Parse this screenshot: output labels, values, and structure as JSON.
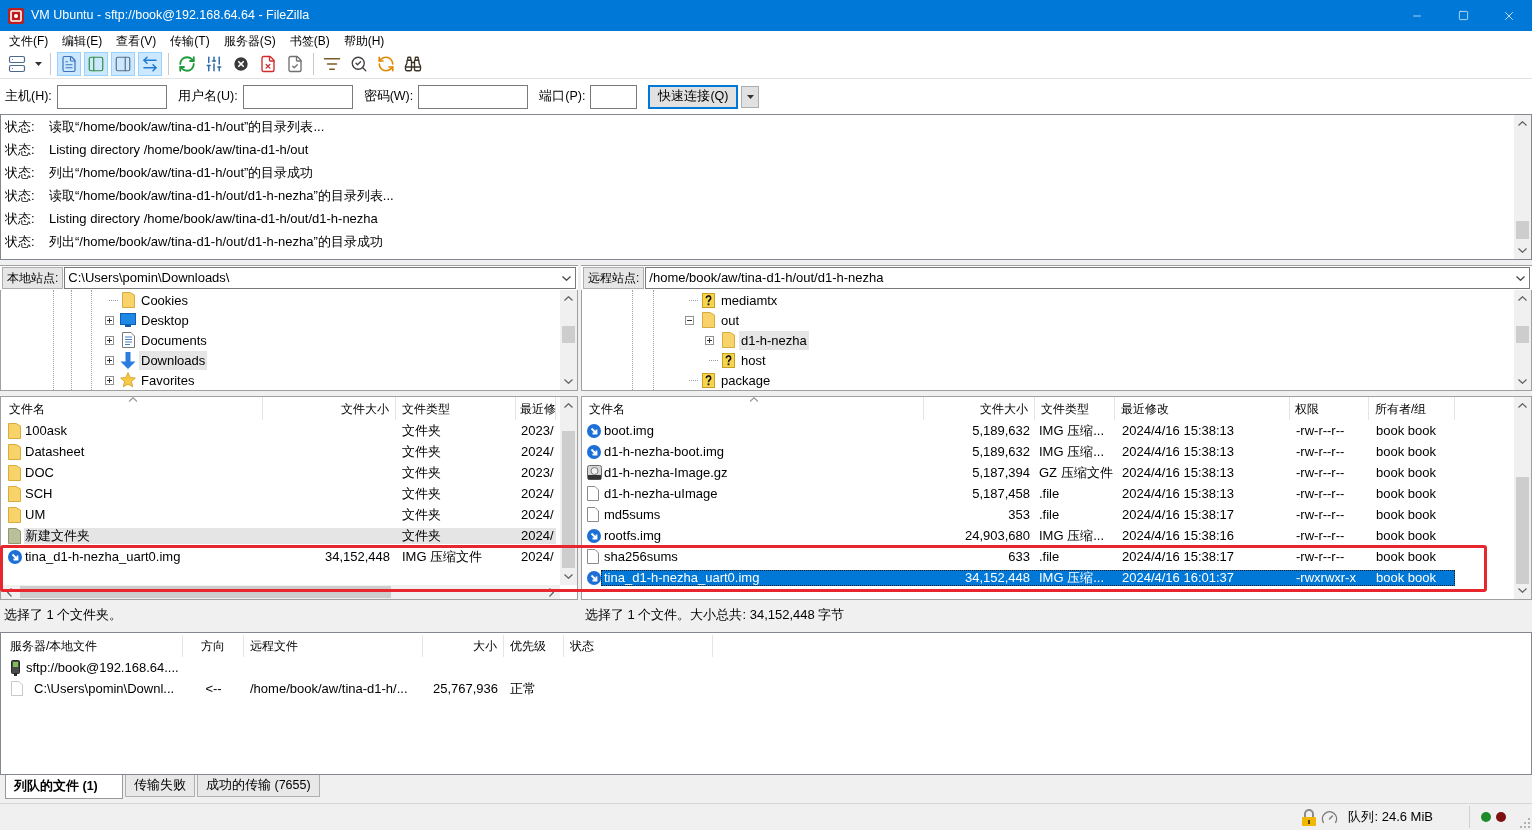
{
  "window": {
    "title": "VM Ubuntu - sftp://book@192.168.64.64 - FileZilla"
  },
  "menu": [
    "文件(F)",
    "编辑(E)",
    "查看(V)",
    "传输(T)",
    "服务器(S)",
    "书签(B)",
    "帮助(H)"
  ],
  "view_toggles": [
    {
      "pressed": true
    },
    {
      "pressed": true
    },
    {
      "pressed": true
    },
    {
      "pressed": true
    }
  ],
  "quickconnect": {
    "fields": [
      {
        "kind": "host",
        "label": "主机(H):"
      },
      {
        "kind": "user",
        "label": "用户名(U):"
      },
      {
        "kind": "password",
        "label": "密码(W):"
      },
      {
        "kind": "port",
        "label": "端口(P):"
      }
    ],
    "button": "快速连接(Q)"
  },
  "log": [
    {
      "label": "状态:",
      "text": "读取“/home/book/aw/tina-d1-h/out”的目录列表..."
    },
    {
      "label": "状态:",
      "text": "Listing directory /home/book/aw/tina-d1-h/out"
    },
    {
      "label": "状态:",
      "text": "列出“/home/book/aw/tina-d1-h/out”的目录成功"
    },
    {
      "label": "状态:",
      "text": "读取“/home/book/aw/tina-d1-h/out/d1-h-nezha”的目录列表..."
    },
    {
      "label": "状态:",
      "text": "Listing directory /home/book/aw/tina-d1-h/out/d1-h-nezha"
    },
    {
      "label": "状态:",
      "text": "列出“/home/book/aw/tina-d1-h/out/d1-h-nezha”的目录成功"
    }
  ],
  "local": {
    "site_label": "本地站点:",
    "path": "C:\\Users\\pomin\\Downloads\\",
    "tree": [
      {
        "name": "Cookies",
        "kind": "folder",
        "expandable": false,
        "selected": false
      },
      {
        "name": "Desktop",
        "kind": "desktop",
        "expandable": true,
        "expanded": false,
        "selected": false
      },
      {
        "name": "Documents",
        "kind": "document",
        "expandable": true,
        "expanded": false,
        "selected": false
      },
      {
        "name": "Downloads",
        "kind": "download",
        "expandable": true,
        "expanded": false,
        "selected": true
      },
      {
        "name": "Favorites",
        "kind": "star",
        "expandable": true,
        "expanded": false,
        "selected": false
      }
    ],
    "focused": false,
    "columns": [
      {
        "label": "文件名",
        "sorted": true
      },
      {
        "label": "文件大小",
        "sorted": false
      },
      {
        "label": "文件类型",
        "sorted": false
      },
      {
        "label": "最近修",
        "sorted": false
      }
    ],
    "rows": [
      {
        "kind": "folder",
        "name": "100ask",
        "type": "文件夹",
        "modified": "2023/",
        "selected": false
      },
      {
        "kind": "folder",
        "name": "Datasheet",
        "type": "文件夹",
        "modified": "2024/",
        "selected": false
      },
      {
        "kind": "folder",
        "name": "DOC",
        "type": "文件夹",
        "modified": "2023/",
        "selected": false
      },
      {
        "kind": "folder",
        "name": "SCH",
        "type": "文件夹",
        "modified": "2024/",
        "selected": false
      },
      {
        "kind": "folder",
        "name": "UM",
        "type": "文件夹",
        "modified": "2024/",
        "selected": false
      },
      {
        "kind": "folder",
        "name": "新建文件夹",
        "type": "文件夹",
        "modified": "2024/",
        "selected": true
      },
      {
        "kind": "img",
        "name": "tina_d1-h-nezha_uart0.img",
        "size": "34,152,448",
        "type": "IMG 压缩文件",
        "modified": "2024/",
        "selected": false
      }
    ],
    "status": "选择了 1 个文件夹。"
  },
  "remote": {
    "site_label": "远程站点:",
    "path": "/home/book/aw/tina-d1-h/out/d1-h-nezha",
    "tree": [
      {
        "name": "mediamtx",
        "kind": "unknown",
        "expandable": false,
        "selected": false
      },
      {
        "name": "out",
        "kind": "folder",
        "expandable": true,
        "expanded": true,
        "selected": false,
        "children": [
          {
            "name": "d1-h-nezha",
            "kind": "folder",
            "expandable": true,
            "expanded": false,
            "selected": true
          },
          {
            "name": "host",
            "kind": "unknown",
            "expandable": false,
            "selected": false
          }
        ]
      },
      {
        "name": "package",
        "kind": "unknown",
        "expandable": false,
        "selected": false
      }
    ],
    "focused": true,
    "columns": [
      {
        "label": "文件名",
        "sorted": true
      },
      {
        "label": "文件大小",
        "sorted": false
      },
      {
        "label": "文件类型",
        "sorted": false
      },
      {
        "label": "最近修改",
        "sorted": false
      },
      {
        "label": "权限",
        "sorted": false
      },
      {
        "label": "所有者/组",
        "sorted": false
      }
    ],
    "rows": [
      {
        "kind": "img",
        "name": "boot.img",
        "size": "5,189,632",
        "type": "IMG 压缩...",
        "modified": "2024/4/16 15:38:13",
        "permissions": "-rw-r--r--",
        "owner": "book book",
        "selected": false
      },
      {
        "kind": "img",
        "name": "d1-h-nezha-boot.img",
        "size": "5,189,632",
        "type": "IMG 压缩...",
        "modified": "2024/4/16 15:38:13",
        "permissions": "-rw-r--r--",
        "owner": "book book",
        "selected": false
      },
      {
        "kind": "gz",
        "name": "d1-h-nezha-Image.gz",
        "size": "5,187,394",
        "type": "GZ 压缩文件",
        "modified": "2024/4/16 15:38:13",
        "permissions": "-rw-r--r--",
        "owner": "book book",
        "selected": false
      },
      {
        "kind": "file",
        "name": "d1-h-nezha-uImage",
        "size": "5,187,458",
        "type": ".file",
        "modified": "2024/4/16 15:38:13",
        "permissions": "-rw-r--r--",
        "owner": "book book",
        "selected": false
      },
      {
        "kind": "file",
        "name": "md5sums",
        "size": "353",
        "type": ".file",
        "modified": "2024/4/16 15:38:17",
        "permissions": "-rw-r--r--",
        "owner": "book book",
        "selected": false
      },
      {
        "kind": "img",
        "name": "rootfs.img",
        "size": "24,903,680",
        "type": "IMG 压缩...",
        "modified": "2024/4/16 15:38:16",
        "permissions": "-rw-r--r--",
        "owner": "book book",
        "selected": false
      },
      {
        "kind": "file",
        "name": "sha256sums",
        "size": "633",
        "type": ".file",
        "modified": "2024/4/16 15:38:17",
        "permissions": "-rw-r--r--",
        "owner": "book book",
        "selected": false
      },
      {
        "kind": "img",
        "name": "tina_d1-h-nezha_uart0.img",
        "size": "34,152,448",
        "type": "IMG 压缩...",
        "modified": "2024/4/16 16:01:37",
        "permissions": "-rwxrwxr-x",
        "owner": "book book",
        "selected": true
      }
    ],
    "status": "选择了 1 个文件。大小总共: 34,152,448 字节"
  },
  "queue": {
    "columns": [
      "服务器/本地文件",
      "方向",
      "远程文件",
      "大小",
      "优先级",
      "状态"
    ],
    "servers": [
      {
        "name": "sftp://book@192.168.64....",
        "children": [
          {
            "local": "C:\\Users\\pomin\\Downl...",
            "direction": "<--",
            "remote": "/home/book/aw/tina-d1-h/...",
            "size": "25,767,936",
            "priority": "正常"
          }
        ]
      }
    ]
  },
  "tabs": [
    {
      "label": "列队的文件 (1)",
      "selected": true
    },
    {
      "label": "传输失败",
      "selected": false
    },
    {
      "label": "成功的传输 (7655)",
      "selected": false
    }
  ],
  "status_bar": {
    "queue": "队列: 24.6 MiB"
  }
}
